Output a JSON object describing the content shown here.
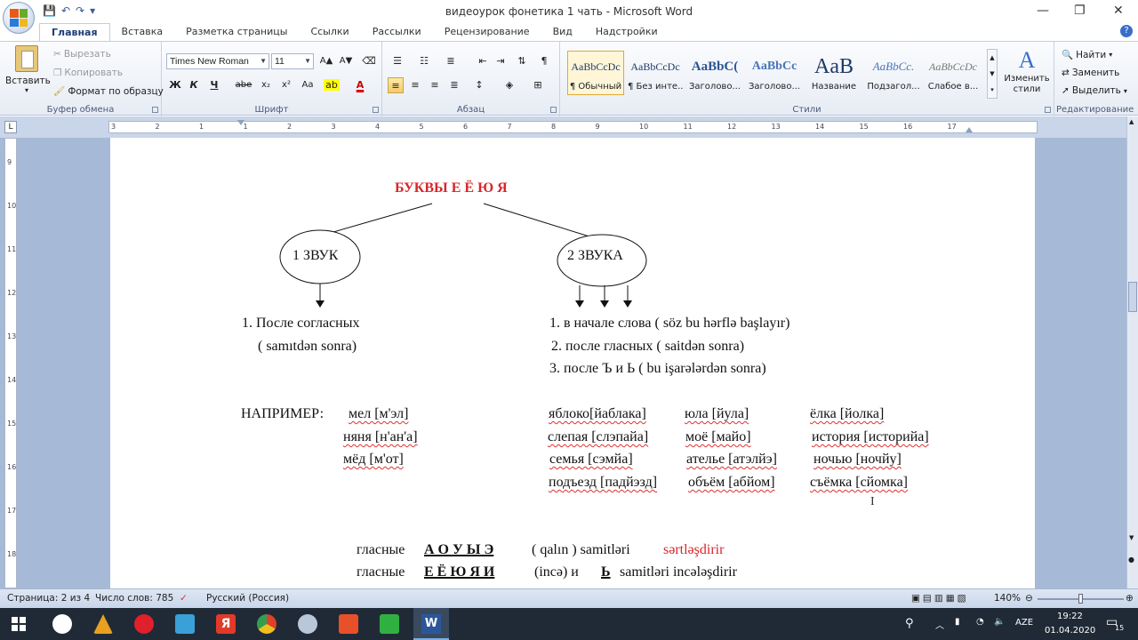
{
  "window": {
    "title": "видеоурок фонетика 1 чать - Microsoft Word",
    "minimize": "—",
    "maximize": "❐",
    "close": "✕"
  },
  "qat": {
    "save": "💾",
    "undo": "↶",
    "redo": "↷",
    "more": "▾"
  },
  "tabs": [
    "Главная",
    "Вставка",
    "Разметка страницы",
    "Ссылки",
    "Рассылки",
    "Рецензирование",
    "Вид",
    "Надстройки"
  ],
  "ribbon": {
    "clipboard": {
      "paste": "Вставить",
      "cut": "Вырезать",
      "copy": "Копировать",
      "format_painter": "Формат по образцу",
      "label": "Буфер обмена"
    },
    "font": {
      "name": "Times New Roman",
      "size": "11",
      "label": "Шрифт",
      "bold": "Ж",
      "italic": "К",
      "underline": "Ч",
      "strike": "abe",
      "sub": "x₂",
      "sup": "x²",
      "case": "Aa",
      "grow": "A▲",
      "shrink": "A▼"
    },
    "paragraph": {
      "label": "Абзац"
    },
    "styles": {
      "label": "Стили",
      "items": [
        {
          "sample": "AaBbCcDc",
          "name": "¶ Обычный"
        },
        {
          "sample": "AaBbCcDc",
          "name": "¶ Без инте..."
        },
        {
          "sample": "AaBbC(",
          "name": "Заголово..."
        },
        {
          "sample": "AaBbCc",
          "name": "Заголово..."
        },
        {
          "sample": "AaB",
          "name": "Название"
        },
        {
          "sample": "AaBbCc.",
          "name": "Подзагол..."
        },
        {
          "sample": "AaBbCcDc",
          "name": "Слабое в..."
        }
      ],
      "change": "Изменить стили"
    },
    "editing": {
      "find": "Найти",
      "replace": "Заменить",
      "select": "Выделить",
      "label": "Редактирование"
    }
  },
  "ruler": {
    "marks": [
      "3",
      "2",
      "1",
      "1",
      "2",
      "3",
      "4",
      "5",
      "6",
      "7",
      "8",
      "9",
      "10",
      "11",
      "12",
      "13",
      "14",
      "15",
      "16",
      "17"
    ]
  },
  "vruler": {
    "marks": [
      "9",
      "10",
      "11",
      "12",
      "13",
      "14",
      "15",
      "16",
      "17",
      "18"
    ]
  },
  "document": {
    "heading": "БУКВЫ   Е  Ё  Ю  Я",
    "ellipse1": "1 ЗВУК",
    "ellipse2": "2 ЗВУКА",
    "left_rule_1": "1. После  согласных",
    "left_rule_2": "( samıtdən sonra)",
    "right_rule_1": "1. в начале слова ( söz bu hərflə başlayır)",
    "right_rule_2": "2. после гласных  ( saitdən sonra)",
    "right_rule_3": "3. после   Ъ  и  Ь    ( bu işarələrdən sonra)",
    "example_label": "НАПРИМЕР:",
    "ex_left": [
      "мел [м'эл]",
      "няня [н'ан'а]",
      "мёд   [м'от]"
    ],
    "ex_mid": [
      "яблоко[йаблака]",
      "слепая [слэпайа]",
      "семья  [сэмйа]",
      "подъезд [падйэзд]"
    ],
    "ex_mid2": [
      "юла [йула]",
      "моё [майо]",
      "ателье  [атэлйэ]",
      "объём [абйом]"
    ],
    "ex_right": [
      "ёлка [йолка]",
      "история  [историйа]",
      "ночью [ночйу]",
      "съёмка  [сйомка]"
    ],
    "bottom1_a": "гласные",
    "bottom1_b": "А   О   У   Ы   Э",
    "bottom1_c": "( qalın )   samitləri",
    "bottom1_d": "sərtləşdirir",
    "bottom2_a": "гласные",
    "bottom2_b": "Е   Ё   Ю   Я   И",
    "bottom2_c": "(incə)  и",
    "bottom2_d": "Ь",
    "bottom2_e": "samitləri incələşdirir"
  },
  "status": {
    "page": "Страница: 2 из 4",
    "words": "Число слов: 785",
    "lang": "Русский (Россия)",
    "zoom": "140%"
  },
  "taskbar": {
    "lang": "AZE",
    "time": "19:22",
    "date": "01.04.2020",
    "notif": "15"
  },
  "colors": {
    "accent": "#d8262a",
    "ribbon": "#e7ecf4",
    "taskbar": "#202a36"
  }
}
